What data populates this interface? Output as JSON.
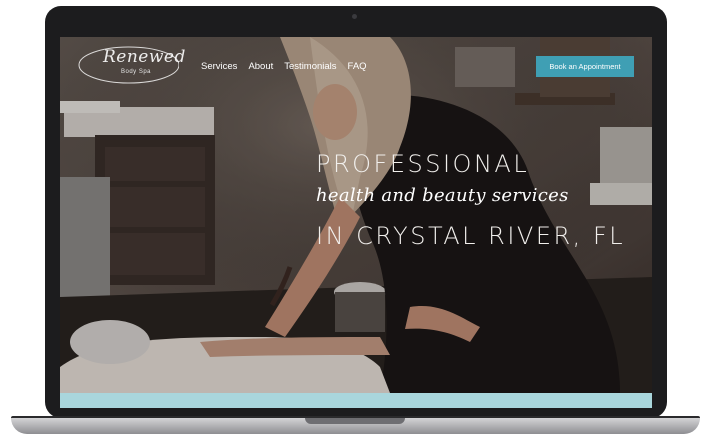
{
  "site": {
    "logo": {
      "script": "Renewed",
      "sub": "Body Spa"
    },
    "nav": [
      {
        "label": "Services"
      },
      {
        "label": "About"
      },
      {
        "label": "Testimonials"
      },
      {
        "label": "FAQ"
      }
    ],
    "cta_label": "Book an Appointment",
    "hero": {
      "line1": "PROFESSIONAL",
      "line2": "health and beauty services",
      "line3": "IN CRYSTAL RIVER, FL"
    },
    "colors": {
      "accent": "#3f9fb4",
      "strip": "#a9d6dc",
      "bezel": "#1c1c1e"
    }
  }
}
